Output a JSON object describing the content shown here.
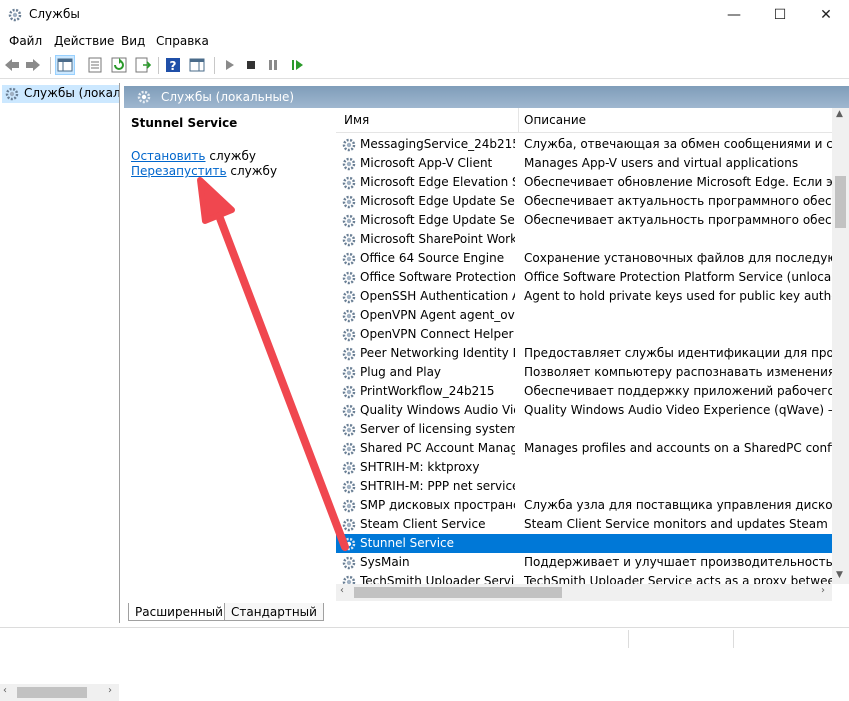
{
  "window": {
    "title": "Службы"
  },
  "menu": [
    "Файл",
    "Действие",
    "Вид",
    "Справка"
  ],
  "tree": {
    "root_label": "Службы (локалы"
  },
  "header": {
    "label": "Службы (локальные)"
  },
  "actions": {
    "service_name": "Stunnel Service",
    "stop_link": "Остановить",
    "stop_suffix": "службу",
    "restart_link": "Перезапустить",
    "restart_suffix": "службу"
  },
  "columns": {
    "name": "Имя",
    "description": "Описание"
  },
  "services": [
    {
      "name": "MessagingService_24b215",
      "description": "Служба, отвечающая за обмен сообщениями и связанн"
    },
    {
      "name": "Microsoft App-V Client",
      "description": "Manages App-V users and virtual applications"
    },
    {
      "name": "Microsoft Edge Elevation Se...",
      "description": "Обеспечивает обновление Microsoft Edge. Если эта служ"
    },
    {
      "name": "Microsoft Edge Update Servi...",
      "description": "Обеспечивает актуальность программного обеспечен"
    },
    {
      "name": "Microsoft Edge Update Servi...",
      "description": "Обеспечивает актуальность программного обеспечен"
    },
    {
      "name": "Microsoft SharePoint Works...",
      "description": ""
    },
    {
      "name": "Office 64 Source Engine",
      "description": "Сохранение установочных файлов для последующего"
    },
    {
      "name": "Office Software Protection ...",
      "description": "Office Software Protection Platform Service (unlocalized de"
    },
    {
      "name": "OpenSSH Authentication A...",
      "description": "Agent to hold private keys used for public key authenticati"
    },
    {
      "name": "OpenVPN Agent agent_ovp...",
      "description": ""
    },
    {
      "name": "OpenVPN Connect Helper S...",
      "description": ""
    },
    {
      "name": "Peer Networking Identity M...",
      "description": "Предоставляет службы идентификации для протокола"
    },
    {
      "name": "Plug and Play",
      "description": "Позволяет компьютеру распознавать изменения в уста"
    },
    {
      "name": "PrintWorkflow_24b215",
      "description": "Обеспечивает поддержку приложений рабочего проце"
    },
    {
      "name": "Quality Windows Audio Vid...",
      "description": "Quality Windows Audio Video Experience (qWave) — сете"
    },
    {
      "name": "Server of licensing system (...",
      "description": ""
    },
    {
      "name": "Shared PC Account Manager",
      "description": "Manages profiles and accounts on a SharedPC configured"
    },
    {
      "name": "SHTRIH-M: kktproxy",
      "description": ""
    },
    {
      "name": "SHTRIH-M: PPP net service",
      "description": ""
    },
    {
      "name": "SMP дисковых пространст...",
      "description": "Служба узла для поставщика управления дисковыми п"
    },
    {
      "name": "Steam Client Service",
      "description": "Steam Client Service monitors and updates Steam content"
    },
    {
      "name": "Stunnel Service",
      "description": "",
      "selected": true
    },
    {
      "name": "SysMain",
      "description": "Поддерживает и улучшает производительность систем"
    },
    {
      "name": "TechSmith Uploader Service",
      "description": "TechSmith Uploader Service acts as a proxy between the re"
    }
  ],
  "tabs": [
    "Расширенный",
    "Стандартный"
  ],
  "colors": {
    "selection": "#0078d7",
    "link": "#0066cc",
    "arrow": "#f0474f",
    "header_band": "#8aa6c1"
  },
  "icons": [
    "gear-icon",
    "back-arrow-icon",
    "forward-arrow-icon",
    "play-icon",
    "stop-icon",
    "pause-icon",
    "resume-icon",
    "help-icon"
  ]
}
